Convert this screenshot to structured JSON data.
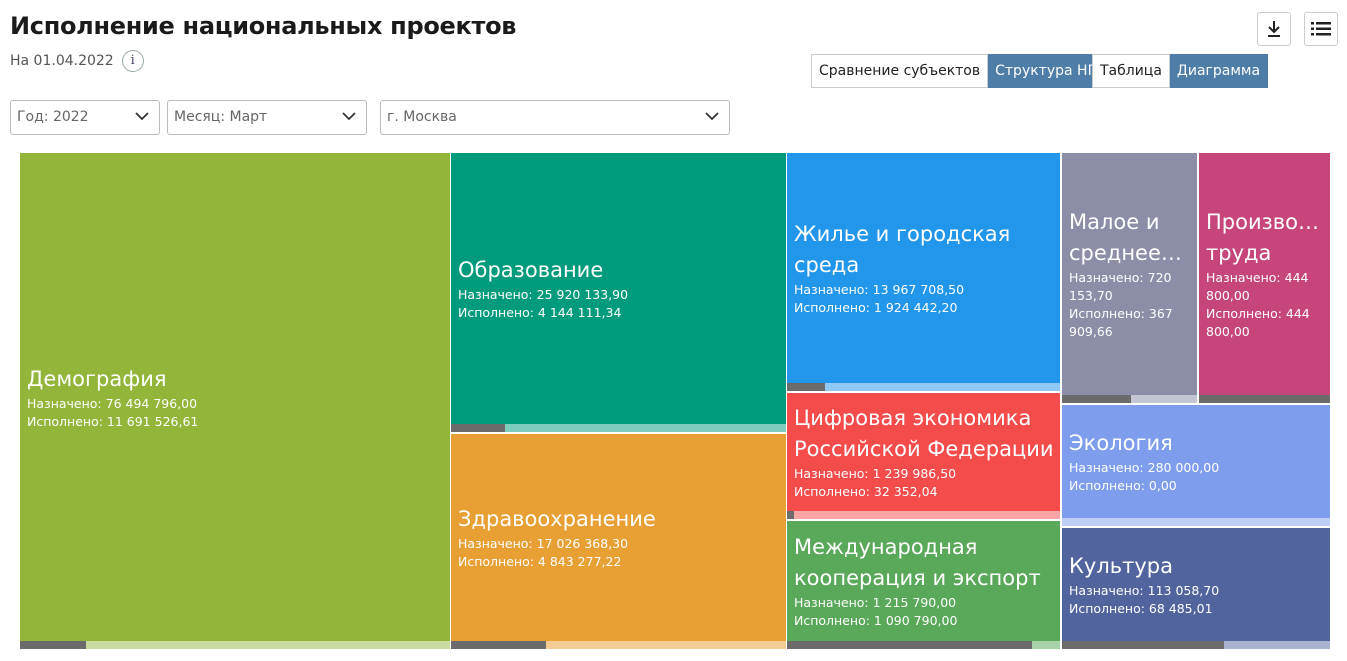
{
  "header": {
    "title": "Исполнение национальных проектов",
    "date": "На 01.04.2022",
    "info_glyph": "i"
  },
  "toolbar": {
    "download_icon": "download-icon",
    "menu_icon": "list-menu-icon"
  },
  "view_toggle": {
    "compare": "Сравнение субъектов",
    "structure": "Структура НП",
    "active": "structure"
  },
  "display_toggle": {
    "table": "Таблица",
    "diagram": "Диаграмма",
    "active": "diagram"
  },
  "filters": {
    "year": "Год: 2022",
    "month": "Месяц: Март",
    "region": "г. Москва"
  },
  "labels": {
    "assigned": "Назначено:",
    "executed": "Исполнено:"
  },
  "chart_data": {
    "type": "treemap",
    "series": [
      {
        "name": "Демография",
        "assigned": 76494796.0,
        "executed": 11691526.61,
        "assigned_text": "76 494 796,00",
        "executed_text": "11 691 526,61",
        "color": "#93b53a",
        "track": "#c9db9e",
        "fraction": 0.153
      },
      {
        "name": "Образование",
        "assigned": 25920133.9,
        "executed": 4144111.34,
        "assigned_text": "25 920 133,90",
        "executed_text": "4 144 111,34",
        "color": "#009a7c",
        "track": "#7fccbd",
        "fraction": 0.16
      },
      {
        "name": "Здравоохранение",
        "assigned": 17026368.3,
        "executed": 4843277.22,
        "assigned_text": "17 026 368,30",
        "executed_text": "4 843 277,22",
        "color": "#e89f33",
        "track": "#f3cc94",
        "fraction": 0.284
      },
      {
        "name": "Жилье и городская среда",
        "assigned": 13967708.5,
        "executed": 1924442.2,
        "assigned_text": "13 967 708,50",
        "executed_text": "1 924 442,20",
        "color": "#2196eb",
        "track": "#8fc8f4",
        "fraction": 0.138
      },
      {
        "name": "Цифровая экономика Российской Федерации",
        "assigned": 1239986.5,
        "executed": 32352.04,
        "assigned_text": "1 239 986,50",
        "executed_text": "32 352,04",
        "color": "#f44b4b",
        "track": "#f9a5a5",
        "fraction": 0.026
      },
      {
        "name": "Международная кооперация и экспорт",
        "assigned": 1215790.0,
        "executed": 1090790.0,
        "assigned_text": "1 215 790,00",
        "executed_text": "1 090 790,00",
        "color": "#5aa859",
        "track": "#a8d2a7",
        "fraction": 0.897
      },
      {
        "name": "Малое и среднее…",
        "assigned": 720153.7,
        "executed": 367909.66,
        "assigned_text": "720 153,70",
        "executed_text": "367 909,66",
        "color": "#8b8ea6",
        "track": "#c3c5d2",
        "fraction": 0.511
      },
      {
        "name": "Произво… труда",
        "assigned": 444800.0,
        "executed": 444800.0,
        "assigned_text": "444 800,00",
        "executed_text": "444 800,00",
        "color": "#c6457b",
        "track": "#e2a2bd",
        "fraction": 1.0
      },
      {
        "name": "Экология",
        "assigned": 280000.0,
        "executed": 0.0,
        "assigned_text": "280 000,00",
        "executed_text": "0,00",
        "color": "#7e9ded",
        "track": "#bfcef6",
        "fraction": 0.0
      },
      {
        "name": "Культура",
        "assigned": 113058.7,
        "executed": 68485.01,
        "assigned_text": "113 058,70",
        "executed_text": "68 485,01",
        "color": "#52649e",
        "track": "#a9b2cf",
        "fraction": 0.606
      }
    ]
  }
}
